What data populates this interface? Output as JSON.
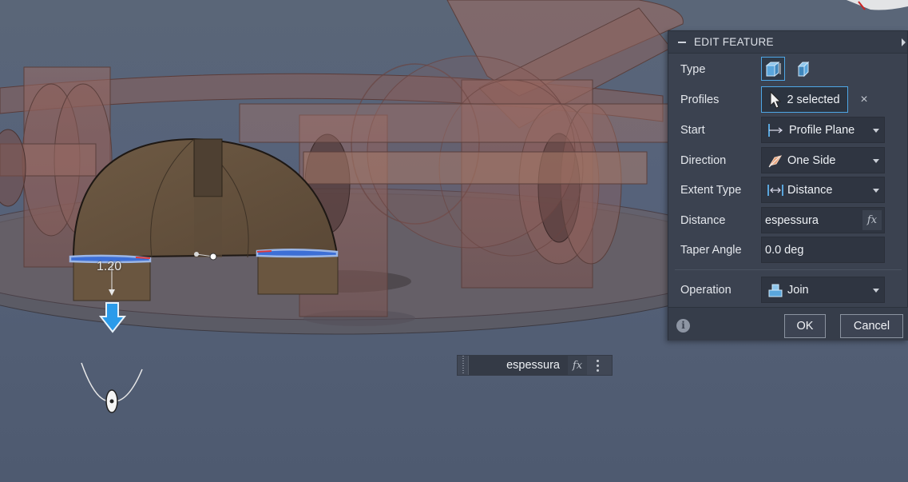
{
  "panel": {
    "title": "EDIT FEATURE",
    "rows": {
      "type": {
        "label": "Type"
      },
      "profiles": {
        "label": "Profiles",
        "value": "2 selected"
      },
      "start": {
        "label": "Start",
        "value": "Profile Plane"
      },
      "direction": {
        "label": "Direction",
        "value": "One Side"
      },
      "extent_type": {
        "label": "Extent Type",
        "value": "Distance"
      },
      "distance": {
        "label": "Distance",
        "value": "espessura",
        "fx": "fx"
      },
      "taper": {
        "label": "Taper Angle",
        "value": "0.0 deg"
      },
      "operation": {
        "label": "Operation",
        "value": "Join"
      }
    },
    "ok_label": "OK",
    "cancel_label": "Cancel",
    "info_glyph": "i",
    "clear_glyph": "×"
  },
  "floating_input": {
    "value": "espessura",
    "fx": "fx"
  },
  "dimension_label": "1.20",
  "colors": {
    "accent": "#4ea7e6",
    "panel_bg": "#3b4250",
    "model_body": "#8a5a55",
    "selected_profile": "#3d6fd6"
  },
  "icons": [
    "extrude-solid-icon",
    "extrude-surface-icon",
    "cursor-arrow-icon",
    "profile-plane-icon",
    "one-side-direction-icon",
    "distance-icon",
    "join-icon",
    "info-icon",
    "drag-arrow-icon"
  ]
}
